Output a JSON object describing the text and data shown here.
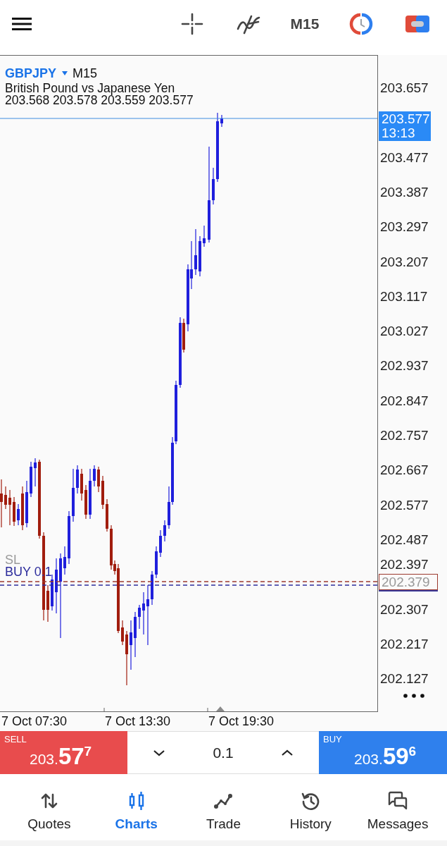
{
  "toolbar": {
    "timeframe": "M15"
  },
  "chart": {
    "symbol": "GBPJPY",
    "timeframe": "M15",
    "description": "British Pound vs Japanese Yen",
    "ohlc": "203.568 203.578 203.559 203.577",
    "order_labels": [
      {
        "kind": "stop_loss",
        "text": "SL"
      },
      {
        "kind": "position",
        "text": "BUY 0.1"
      }
    ]
  },
  "price_axis": [
    {
      "kind": "tick",
      "label": "203.657"
    },
    {
      "kind": "current",
      "price": "203.577",
      "time": "13:13"
    },
    {
      "kind": "tick",
      "label": "203.477"
    },
    {
      "kind": "tick",
      "label": "203.387"
    },
    {
      "kind": "tick",
      "label": "203.297"
    },
    {
      "kind": "tick",
      "label": "203.207"
    },
    {
      "kind": "tick",
      "label": "203.117"
    },
    {
      "kind": "tick",
      "label": "203.027"
    },
    {
      "kind": "tick",
      "label": "202.937"
    },
    {
      "kind": "tick",
      "label": "202.847"
    },
    {
      "kind": "tick",
      "label": "202.757"
    },
    {
      "kind": "tick",
      "label": "202.667"
    },
    {
      "kind": "tick",
      "label": "202.577"
    },
    {
      "kind": "tick",
      "label": "202.487"
    },
    {
      "kind": "tick",
      "label": "202.397"
    },
    {
      "kind": "order",
      "price": "202.379"
    },
    {
      "kind": "tick",
      "label": "202.307"
    },
    {
      "kind": "tick",
      "label": "202.217"
    },
    {
      "kind": "tick",
      "label": "202.127"
    }
  ],
  "time_axis": [
    "7 Oct 07:30",
    "7 Oct 13:30",
    "7 Oct 19:30"
  ],
  "trade_panel": {
    "sell": {
      "label": "SELL",
      "price": "203.**57**$^{7}$"
    },
    "volume": "0.1",
    "buy": {
      "label": "BUY",
      "price": "203.**59**$^{6}$"
    }
  },
  "bottom_nav": [
    {
      "label": "Quotes",
      "selected": false
    },
    {
      "label": "Charts",
      "selected": true
    },
    {
      "label": "Trade",
      "selected": false
    },
    {
      "label": "History",
      "selected": false
    },
    {
      "label": "Messages",
      "selected": false
    }
  ]
}
